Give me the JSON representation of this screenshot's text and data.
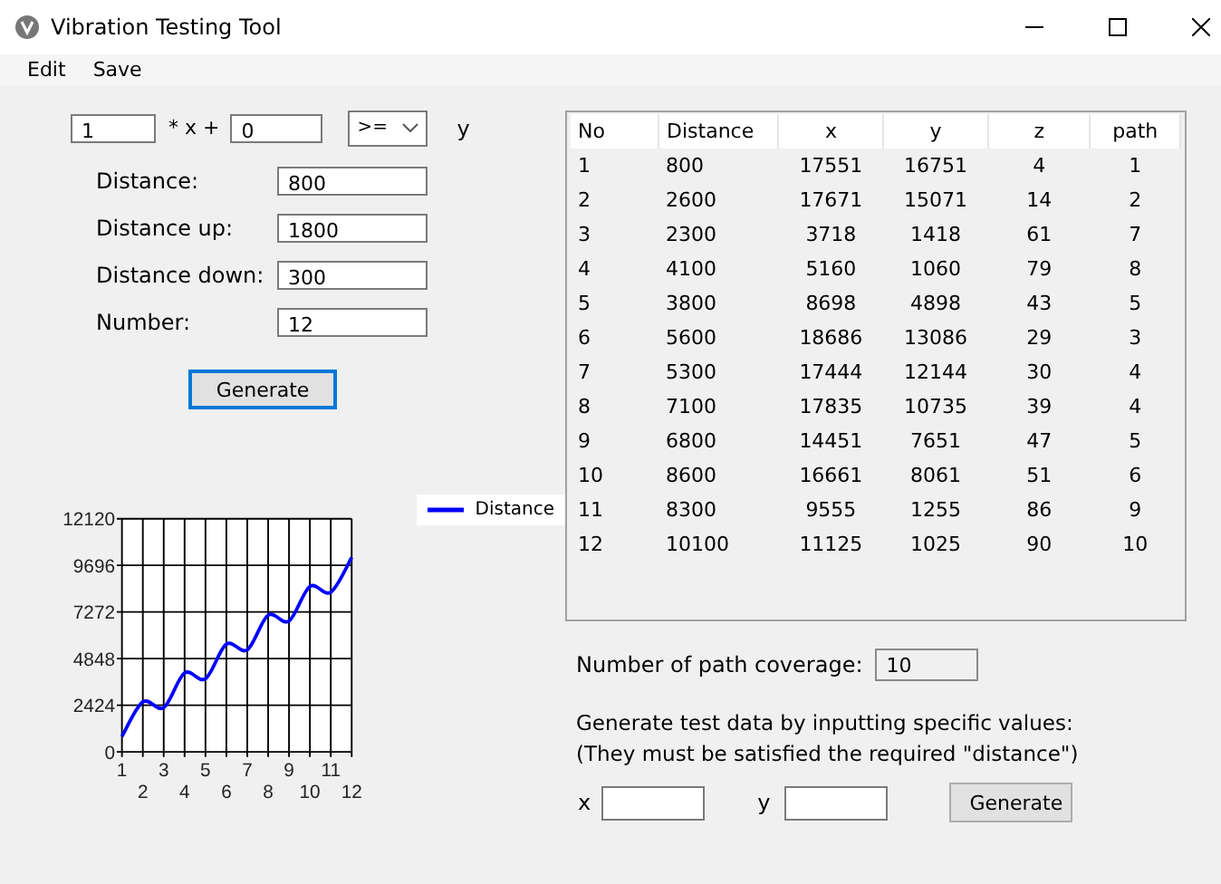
{
  "window": {
    "title": "Vibration Testing Tool"
  },
  "menu": [
    {
      "label": "Edit"
    },
    {
      "label": "Save"
    }
  ],
  "formula": {
    "coefficient": "1",
    "times_x_plus": "* x +",
    "constant": "0",
    "operator": ">=",
    "variable": "y"
  },
  "fields": [
    {
      "label": "Distance:",
      "value": "800"
    },
    {
      "label": "Distance up:",
      "value": "1800"
    },
    {
      "label": "Distance down:",
      "value": "300"
    },
    {
      "label": "Number:",
      "value": "12"
    }
  ],
  "generate_button": "Generate",
  "chart": {
    "chart_data": {
      "type": "line",
      "categories": [
        "1",
        "2",
        "3",
        "4",
        "5",
        "6",
        "7",
        "8",
        "9",
        "10",
        "11",
        "12"
      ],
      "series": [
        {
          "name": "Distance",
          "color": "#0000ff",
          "values": [
            800,
            2600,
            2300,
            4100,
            3800,
            5600,
            5300,
            7100,
            6800,
            8600,
            8300,
            10100
          ]
        }
      ],
      "ylim": [
        0,
        12120
      ],
      "yticks": [
        0,
        2424,
        4848,
        7272,
        9696,
        12120
      ],
      "grid": true
    }
  },
  "table": {
    "columns": [
      "No",
      "Distance",
      "x",
      "y",
      "z",
      "path"
    ],
    "rows": [
      [
        "1",
        "800",
        "17551",
        "16751",
        "4",
        "1"
      ],
      [
        "2",
        "2600",
        "17671",
        "15071",
        "14",
        "2"
      ],
      [
        "3",
        "2300",
        "3718",
        "1418",
        "61",
        "7"
      ],
      [
        "4",
        "4100",
        "5160",
        "1060",
        "79",
        "8"
      ],
      [
        "5",
        "3800",
        "8698",
        "4898",
        "43",
        "5"
      ],
      [
        "6",
        "5600",
        "18686",
        "13086",
        "29",
        "3"
      ],
      [
        "7",
        "5300",
        "17444",
        "12144",
        "30",
        "4"
      ],
      [
        "8",
        "7100",
        "17835",
        "10735",
        "39",
        "4"
      ],
      [
        "9",
        "6800",
        "14451",
        "7651",
        "47",
        "5"
      ],
      [
        "10",
        "8600",
        "16661",
        "8061",
        "51",
        "6"
      ],
      [
        "11",
        "8300",
        "9555",
        "1255",
        "86",
        "9"
      ],
      [
        "12",
        "10100",
        "11125",
        "1025",
        "90",
        "10"
      ]
    ]
  },
  "coverage": {
    "label": "Number of path coverage:",
    "value": "10"
  },
  "note": [
    "Generate test data by inputting specific values:",
    "(They must be satisfied the required \"distance\")"
  ],
  "specific": {
    "x_label": "x",
    "y_label": "y",
    "button": "Generate"
  }
}
